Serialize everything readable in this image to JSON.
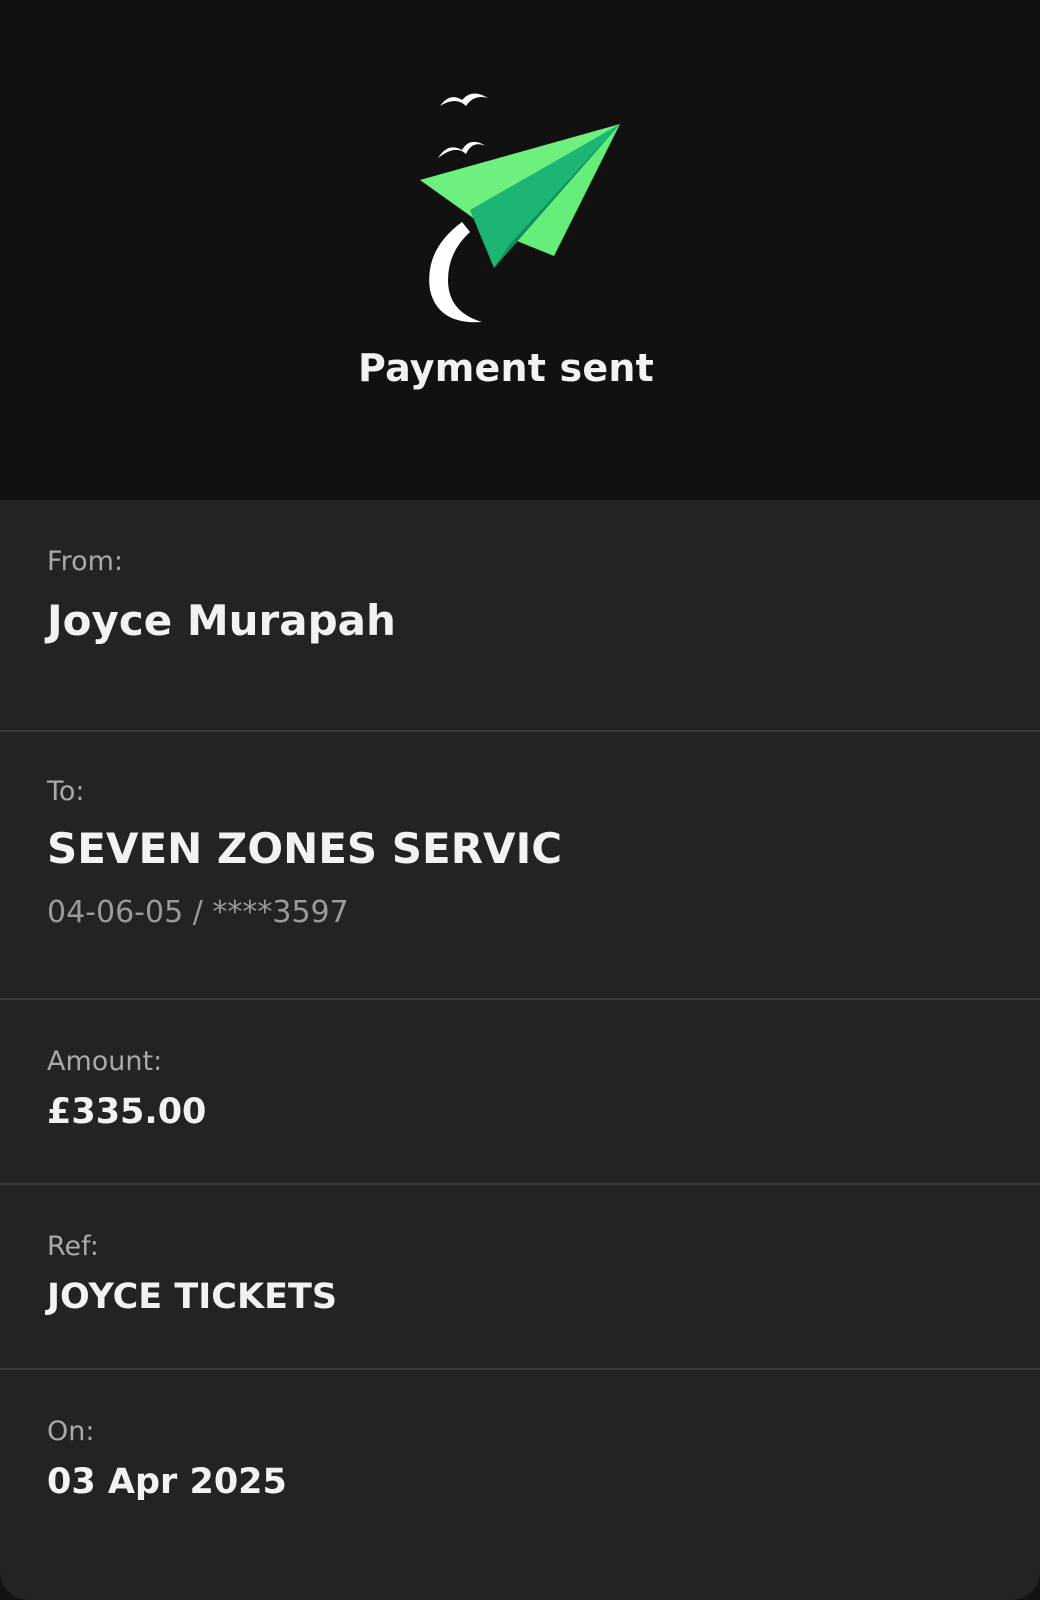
{
  "header": {
    "title": "Payment sent",
    "icon": "paper-plane-icon",
    "accent_colors": [
      "#5ef07a",
      "#1fbf73",
      "#ffffff"
    ]
  },
  "details": {
    "from": {
      "label": "From:",
      "value": "Joyce Murapah"
    },
    "to": {
      "label": "To:",
      "value": "SEVEN ZONES SERVIC",
      "account": "04-06-05 / ****3597"
    },
    "amount": {
      "label": "Amount:",
      "value": "£335.00"
    },
    "ref": {
      "label": "Ref:",
      "value": "JOYCE TICKETS"
    },
    "on": {
      "label": "On:",
      "value": "03 Apr 2025"
    }
  }
}
